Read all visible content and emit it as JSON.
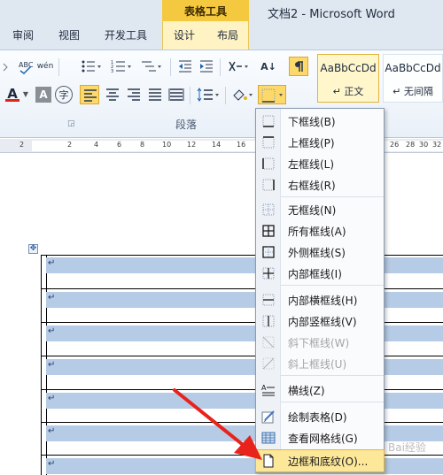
{
  "window": {
    "title": "文档2 - Microsoft Word",
    "context_tab": "表格工具"
  },
  "tabs": [
    "审阅",
    "视图",
    "开发工具",
    "设计",
    "布局"
  ],
  "ribbon": {
    "group_label": "段落",
    "styles": [
      {
        "sample": "AaBbCcDd",
        "name": "↵ 正文",
        "selected": true
      },
      {
        "sample": "AaBbCcDd",
        "name": "↵ 无间隔",
        "selected": false
      }
    ],
    "font_sample_glyph": "A",
    "char_glyph": "字",
    "sort_glyph": "A↓",
    "pinyin_glyph": "wén",
    "text_color": "#e2231a",
    "highlight_color": "#fcd96a"
  },
  "ruler": {
    "ticks": [
      "2",
      "2",
      "4",
      "6",
      "8",
      "10",
      "12",
      "14",
      "16",
      "26",
      "28",
      "30",
      "32"
    ]
  },
  "document": {
    "para_mark": "↵",
    "row_fill_color": "#b6cbe5",
    "move_handle": "✥"
  },
  "border_menu": {
    "items": [
      {
        "label": "下框线(B)",
        "icon": "bottom-border-icon",
        "disabled": false
      },
      {
        "label": "上框线(P)",
        "icon": "top-border-icon",
        "disabled": false
      },
      {
        "label": "左框线(L)",
        "icon": "left-border-icon",
        "disabled": false
      },
      {
        "label": "右框线(R)",
        "icon": "right-border-icon",
        "disabled": false
      },
      {
        "label": "无框线(N)",
        "icon": "no-border-icon",
        "disabled": false
      },
      {
        "label": "所有框线(A)",
        "icon": "all-borders-icon",
        "disabled": false
      },
      {
        "label": "外侧框线(S)",
        "icon": "outside-borders-icon",
        "disabled": false
      },
      {
        "label": "内部框线(I)",
        "icon": "inside-borders-icon",
        "disabled": false
      },
      {
        "label": "内部横框线(H)",
        "icon": "inside-horizontal-border-icon",
        "disabled": false
      },
      {
        "label": "内部竖框线(V)",
        "icon": "inside-vertical-border-icon",
        "disabled": false
      },
      {
        "label": "斜下框线(W)",
        "icon": "diagonal-down-border-icon",
        "disabled": true
      },
      {
        "label": "斜上框线(U)",
        "icon": "diagonal-up-border-icon",
        "disabled": true
      },
      {
        "label": "横线(Z)",
        "icon": "horizontal-line-icon",
        "disabled": false
      },
      {
        "label": "绘制表格(D)",
        "icon": "draw-table-icon",
        "disabled": false
      },
      {
        "label": "查看网格线(G)",
        "icon": "view-gridlines-icon",
        "disabled": false
      },
      {
        "label": "边框和底纹(O)...",
        "icon": "borders-shading-icon",
        "disabled": false,
        "highlighted": true
      }
    ]
  },
  "annotation": {
    "arrow_color": "#e8231b"
  },
  "watermark": "Bai经验"
}
